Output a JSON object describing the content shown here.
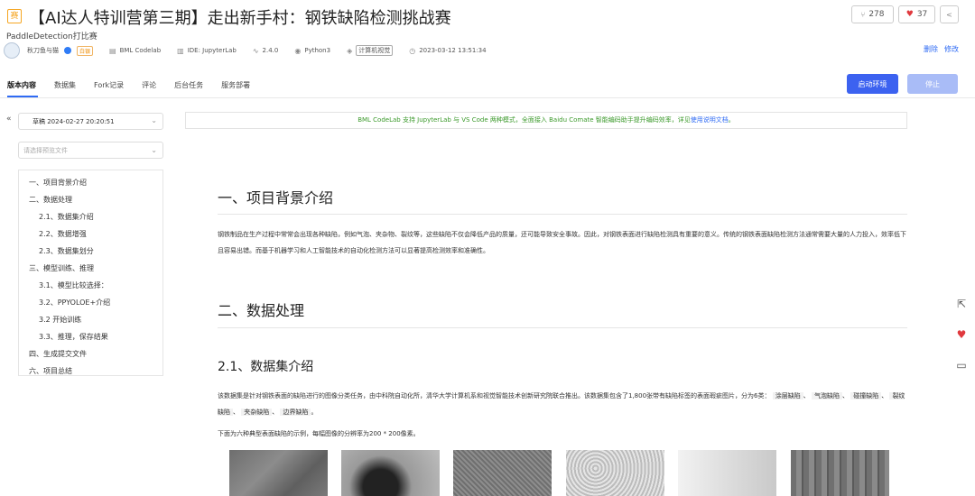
{
  "header": {
    "badge": "赛",
    "title": "【AI达人特训营第三期】走出新手村：钢铁缺陷检测挑战赛",
    "subtitle": "PaddleDetection打比赛",
    "fork_count": "278",
    "like_count": "37"
  },
  "meta": {
    "author": "秋刀鱼与猫",
    "level": "白银",
    "platform": "BML Codelab",
    "ide": "IDE: JupyterLab",
    "version": "2.4.0",
    "language": "Python3",
    "tag": "计算机视觉",
    "timestamp": "2023-03-12 13:51:34",
    "delete": "删除",
    "edit": "修改"
  },
  "tabs": [
    {
      "label": "版本内容",
      "active": true
    },
    {
      "label": "数据集"
    },
    {
      "label": "Fork记录"
    },
    {
      "label": "评论"
    },
    {
      "label": "后台任务"
    },
    {
      "label": "服务部署"
    }
  ],
  "buttons": {
    "start": "启动环境",
    "stop": "停止"
  },
  "sidebar": {
    "draft": "草稿 2024-02-27 20:20:51",
    "file_placeholder": "请选择预览文件",
    "toc": [
      {
        "label": "一、项目背景介绍",
        "level": 1
      },
      {
        "label": "二、数据处理",
        "level": 1
      },
      {
        "label": "2.1、数据集介绍",
        "level": 2
      },
      {
        "label": "2.2、数据增强",
        "level": 2
      },
      {
        "label": "2.3、数据集划分",
        "level": 2
      },
      {
        "label": "三、模型训练、推理",
        "level": 1
      },
      {
        "label": "3.1、模型比较选择：",
        "level": 2
      },
      {
        "label": "3.2、PPYOLOE+介绍",
        "level": 2
      },
      {
        "label": "3.2 开始训练",
        "level": 2
      },
      {
        "label": "3.3、推理，保存结果",
        "level": 2
      },
      {
        "label": "四、生成提交文件",
        "level": 1
      },
      {
        "label": "六、项目总结",
        "level": 1
      }
    ]
  },
  "main": {
    "notice_text": "BML CodeLab 支持 JupyterLab 与 VS Code 两种模式，全面接入 Baidu Comate 智能编码助手提升编码效率，详见",
    "notice_link": "使用说明文档",
    "notice_end": "。",
    "h1_background": "一、项目背景介绍",
    "background_para": "钢铁制品在生产过程中常常会出现各种缺陷，例如气泡、夹杂物、裂纹等，这些缺陷不仅会降低产品的质量，还可能导致安全事故。因此，对钢铁表面进行缺陷检测具有重要的意义。传统的钢铁表面缺陷检测方法通常需要大量的人力投入，效率低下且容易出错。而基于机器学习和人工智能技术的自动化检测方法可以显著提高检测效率和准确性。",
    "h1_data": "二、数据处理",
    "h2_dataset": "2.1、数据集介绍",
    "dataset_para": "该数据集是针对钢铁表面的缺陷进行的图像分类任务，由中科院自动化所，清华大学计算机系和视觉智能技术创新研究院联合推出。该数据集包含了1,800张带有缺陷标签的表面瑕疵图片，分为6类：",
    "defect_classes": [
      "涂层缺陷",
      "气泡缺陷",
      "碰撞缺陷",
      "裂纹缺陷",
      "夹杂缺陷",
      "边界缺陷"
    ],
    "sep": "、",
    "period": "。",
    "image_caption": "下面为六种典型表面缺陷的示例，每幅图像的分辨率为200 * 200像素。"
  }
}
